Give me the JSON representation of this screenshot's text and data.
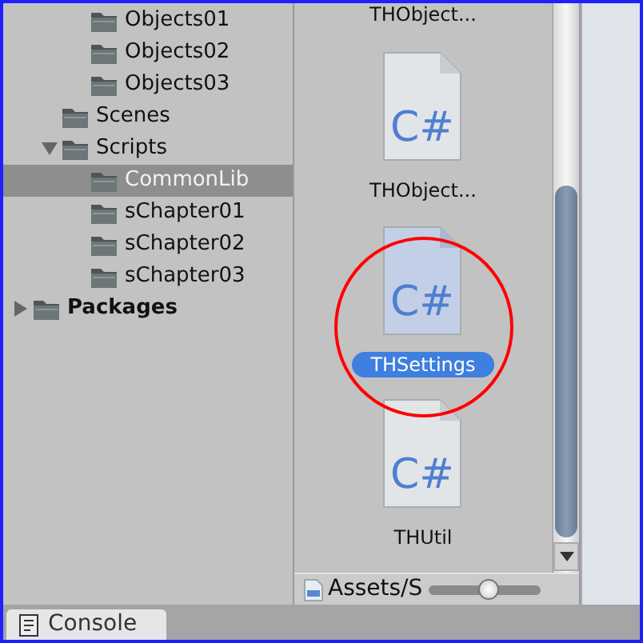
{
  "tree": [
    {
      "children": [
        {
          "children": [
            {
              "label": "Objects01",
              "selected": false
            },
            {
              "label": "Objects02",
              "selected": false
            },
            {
              "label": "Objects03",
              "selected": false
            }
          ]
        },
        {
          "label": "Scenes",
          "selected": false
        },
        {
          "label": "Scripts",
          "selected": false,
          "expanded": true,
          "children": [
            {
              "label": "CommonLib",
              "selected": true
            },
            {
              "label": "sChapter01",
              "selected": false
            },
            {
              "label": "sChapter02",
              "selected": false
            },
            {
              "label": "sChapter03",
              "selected": false
            }
          ]
        }
      ]
    },
    {
      "label": "Packages",
      "selected": false,
      "expanded": false
    }
  ],
  "grid": [
    {
      "name": "THObject...",
      "selected": false
    },
    {
      "name": "THObject...",
      "icon_label": "C#",
      "selected": false
    },
    {
      "name": "THSettings",
      "icon_label": "C#",
      "selected": true,
      "circled": true
    },
    {
      "name": "THUtil",
      "icon_label": "C#",
      "selected": false
    }
  ],
  "status_bar": {
    "path": "Assets/S",
    "zoom": {
      "level": 0.54
    }
  },
  "tabs": [
    {
      "label": "Console",
      "selected": true
    }
  ]
}
